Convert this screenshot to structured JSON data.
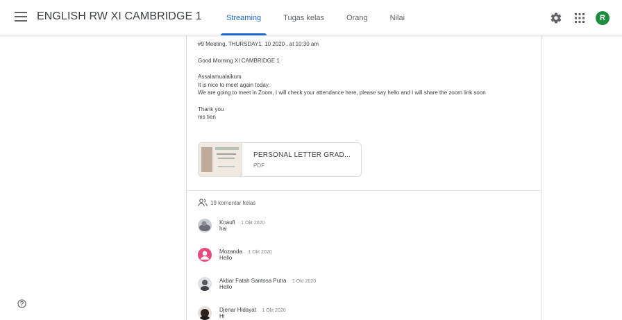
{
  "header": {
    "class_title": "ENGLISH RW XI CAMBRIDGE 1",
    "tabs": [
      {
        "label": "Streaming",
        "active": true
      },
      {
        "label": "Tugas kelas",
        "active": false
      },
      {
        "label": "Orang",
        "active": false
      },
      {
        "label": "Nilai",
        "active": false
      }
    ],
    "icons": {
      "menu": "menu-icon",
      "settings": "gear-icon",
      "apps": "apps-grid-icon"
    },
    "user_avatar_letter": "R"
  },
  "post": {
    "lines": [
      "#9 Meeting. THURSDAY1. 10 2020 . at 10:30 am",
      "Good Morning XI CAMBRIDGE 1",
      "Assalamualaikum",
      "It is nice to meet again today.",
      "We are going to meet in Zoom, I will check your attendance here, please say hello and I will share the zoom link soon",
      "Thank you",
      "ms tien"
    ],
    "attachment": {
      "title": "PERSONAL LETTER GRAD...",
      "type": "PDF"
    }
  },
  "comments": {
    "count_label": "19 komentar kelas",
    "items": [
      {
        "author": "Knaufl",
        "date": "1 Okt 2020",
        "text": "hai"
      },
      {
        "author": "Mozanda",
        "date": "1 Okt 2020",
        "text": "Hello"
      },
      {
        "author": "Akbar Fatah Santosa Putra",
        "date": "1 Okt 2020",
        "text": "Hello"
      },
      {
        "author": "Djenar Hidayat",
        "date": "1 Okt 2020",
        "text": "Hi"
      }
    ]
  },
  "colors": {
    "accent": "#1967d2",
    "avatar_green": "#1e8e3e",
    "avatar_pink": "#e84a7a"
  }
}
